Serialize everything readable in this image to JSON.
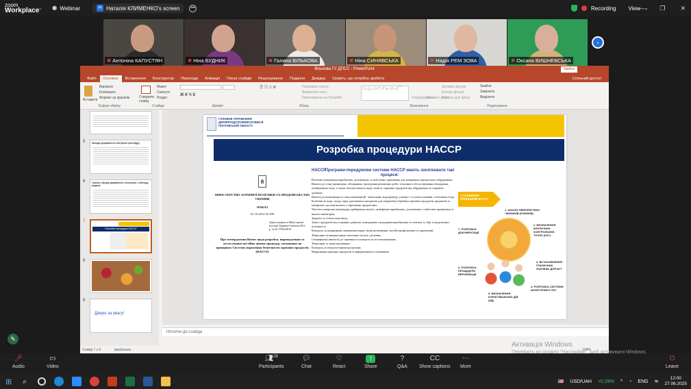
{
  "zoom": {
    "logo_line1": "zoom",
    "logo_line2": "Workplace",
    "meeting_label": "Webinar",
    "share_label": "Наталія КЛИМЕНКО's screen",
    "share_badge": "H",
    "recording": "Recording",
    "view": "View"
  },
  "participants": [
    {
      "name": "Антоніна КАПУСТЯН",
      "bg": "#4a4642",
      "skin": "#c99a82",
      "shirt": "#2c2a2a"
    },
    {
      "name": "Ніна БУДНИК",
      "bg": "#3b3130",
      "skin": "#d1a38f",
      "shirt": "#7a3a80"
    },
    {
      "name": "Галина ВІЛЬКОВА",
      "bg": "#6d6b67",
      "skin": "#dcae92",
      "shirt": "#f0e9e4"
    },
    {
      "name": "Ніна СИНЯВСЬКА",
      "bg": "#9c8c7a",
      "skin": "#c89478",
      "shirt": "#d4b44a"
    },
    {
      "name": "Надія РЕМ ЗОВА",
      "bg": "#d8d6d2",
      "skin": "#e0b8a0",
      "shirt": "#2f5fa8"
    },
    {
      "name": "Оксана ВИШНЕВСЬКА",
      "bg": "#2e9c56",
      "skin": "#d8b09a",
      "shirt": "#d4b07a"
    }
  ],
  "powerpoint": {
    "title": "Візькова ГУ ДПСС - PowerPoint",
    "sign_in": "Увійти",
    "tabs": [
      "Файл",
      "Основне",
      "Вставлення",
      "Конструктор",
      "Переходи",
      "Анімація",
      "Показ слайдів",
      "Рецензування",
      "Подання",
      "Довідка",
      "Скажіть, що потрібно зробити"
    ],
    "selected_tab": "Основне",
    "share": "Спільний доступ",
    "ribbon": {
      "paste": "Вставити",
      "cut": "Вирізати",
      "copy": "Копіювати",
      "format_painter": "Формат за зразком",
      "clipboard": "Буфер обміну",
      "new_slide": "Створити слайд",
      "layout": "Макет",
      "reset": "Скинути",
      "section": "Розділ",
      "slides": "Слайди",
      "font": "Шрифт",
      "paragraph": "Абзац",
      "text_dir": "Напрямок тексту",
      "align_text": "Вирівняти текст",
      "smartart": "Перетворити на SmartArt",
      "drawing": "Малювання",
      "arrange": "Упорядкувати",
      "quick_styles": "Експрес-стилі",
      "shape_fill": "Заливка фігури",
      "shape_outline": "Контур фігури",
      "shape_effects": "Ефекти для фігур",
      "find": "Знайти",
      "replace": "Замінити",
      "select": "Виділити",
      "editing": "Редагування"
    },
    "thumbnails": [
      {
        "num": "5",
        "title": "Заходи державного контролю (нагляду):"
      },
      {
        "num": "6",
        "title": "Оцінки з форм державного контролю з нагляду (аудит):"
      },
      {
        "num": "7",
        "title": "Розробка процедури НАССР"
      },
      {
        "num": "8",
        "title": ""
      },
      {
        "num": "9",
        "title": "Дякую за увагу!"
      }
    ],
    "slide": {
      "org": "ГОЛОВНЕ УПРАВЛІННЯ ДЕРЖПРОДСПОЖИВСЛУЖБИ В ПОЛТАВСЬКІЙ ОБЛАСТІ",
      "title": "Розробка процедури НАССР",
      "ministry": "МІНІСТЕРСТВО АГРАРНОЇ ПОЛІТИКИ ТА ПРОДОВОЛЬСТВА УКРАЇНИ",
      "order": "НАКАЗ",
      "order_date": "01.10.2012 № 590",
      "registered": "Зареєстровано в Міністерстві юстиції України 9 жовтня 2012 р. за № 1704/22016",
      "order_title": "Про затвердження Вимог щодо розробки, впровадження та застосування постійно діючих процедур, заснованих на принципах Системи управління безпечністю харчових продуктів (НАССР)",
      "haccp_logo": "НАССР",
      "haccp_heading": "Програми-передумови системи НАССР мають охоплювати такі процеси:",
      "haccp_items": [
        "Належне планування виробничих, допоміжних та побутових приміщень для уникнення перехресного забруднення;",
        "Вимоги до стану приміщень, обладнання, проведення ремонтних робіт, технічного обслуговування обладнання, калібрування тощо, а також загальні вимоги щодо захисту харчових продуктів від забруднення та сторонніх домішок;",
        "Вимоги до планування та стану комунікацій - вентиляції, водопроводу, електро- та газопостачання, освітлення тощо;",
        "Безпечність води, льоду, пари, допоміжних матеріалів для переробки (обробки) харчових продуктів, предметів та матеріалів, що контактують з харчовими продуктами;",
        "Чистота поверхонь (процедури прибирання, миття і дезінфекції виробничих, допоміжних і побутових приміщень та іншого інвентарю);",
        "Здоров'я та гігієна персоналу;",
        "Захист продуктів від сторонніх домішок, поводження з відходами виробництва та сміттям, їх збір та видалення з потужності;",
        "Контроль за шкідниками, визначення видів, місць розміщення, засобів профілактики та дератизації;",
        "Зберігання та використання токсичних сполук і речовин;",
        "Специфікації (вимоги) до сировини та контроль за постачальниками;",
        "Зберігання та транспортування;",
        "Контроль за технологічними процесами;",
        "Маркування харчових продуктів та інформованість споживачів."
      ],
      "principles_arrow": "7 ОСНОВНИХ ПРИНЦИПІВ НАССР",
      "principles": [
        "1. АНАЛІЗ НЕБЕЗПЕЧНИХ ЧИННИКІВ (РИЗИКІВ)",
        "2. ВИЗНАЧЕННЯ КРИТИЧНИХ КОНТРОЛЬНИХ ТОЧОК (ККТ)",
        "3. ВСТАНОВЛЕННЯ ГРАНИЧНИХ ЗНАЧЕНЬ ДЛЯ ККТ",
        "4. РОЗРОБКА СИСТЕМИ МОНІТОРИНГУ ККТ",
        "5. ВИЗНАЧЕННЯ КОРИГУВАЛЬНИХ ДІЙ (КД)",
        "6. РОЗРОБКА ПРОЦЕДУРИ ВЕРИФІКАЦІЇ",
        "7. РОЗРОБКА ДОКУМЕНТАЦІЇ"
      ]
    },
    "notes": "Нотатки до слайда",
    "status_slide": "Слайд 7 з 9",
    "status_lang": "українська",
    "zoom_level": "104%"
  },
  "windows_watermark": {
    "line1": "Активація Windows",
    "line2": "Перейдіть до розділу \"Настройки\", щоб активувати Windows."
  },
  "toolbar": {
    "audio": "Audio",
    "video": "Video",
    "participants": "Participants",
    "participants_count": "109",
    "chat": "Chat",
    "react": "React",
    "share": "Share",
    "qa": "Q&A",
    "captions": "Show captions",
    "more": "More",
    "leave": "Leave"
  },
  "taskbar": {
    "currency": "USD/UAH",
    "change": "+0.29%",
    "lang": "ENG",
    "time": "12:00",
    "date": "27.06.2025"
  },
  "colors": {
    "ppt_accent": "#b7472a",
    "zoom_share": "#1f6fde",
    "slide_yellow": "#f5c400",
    "slide_blue": "#0e2d6b"
  }
}
